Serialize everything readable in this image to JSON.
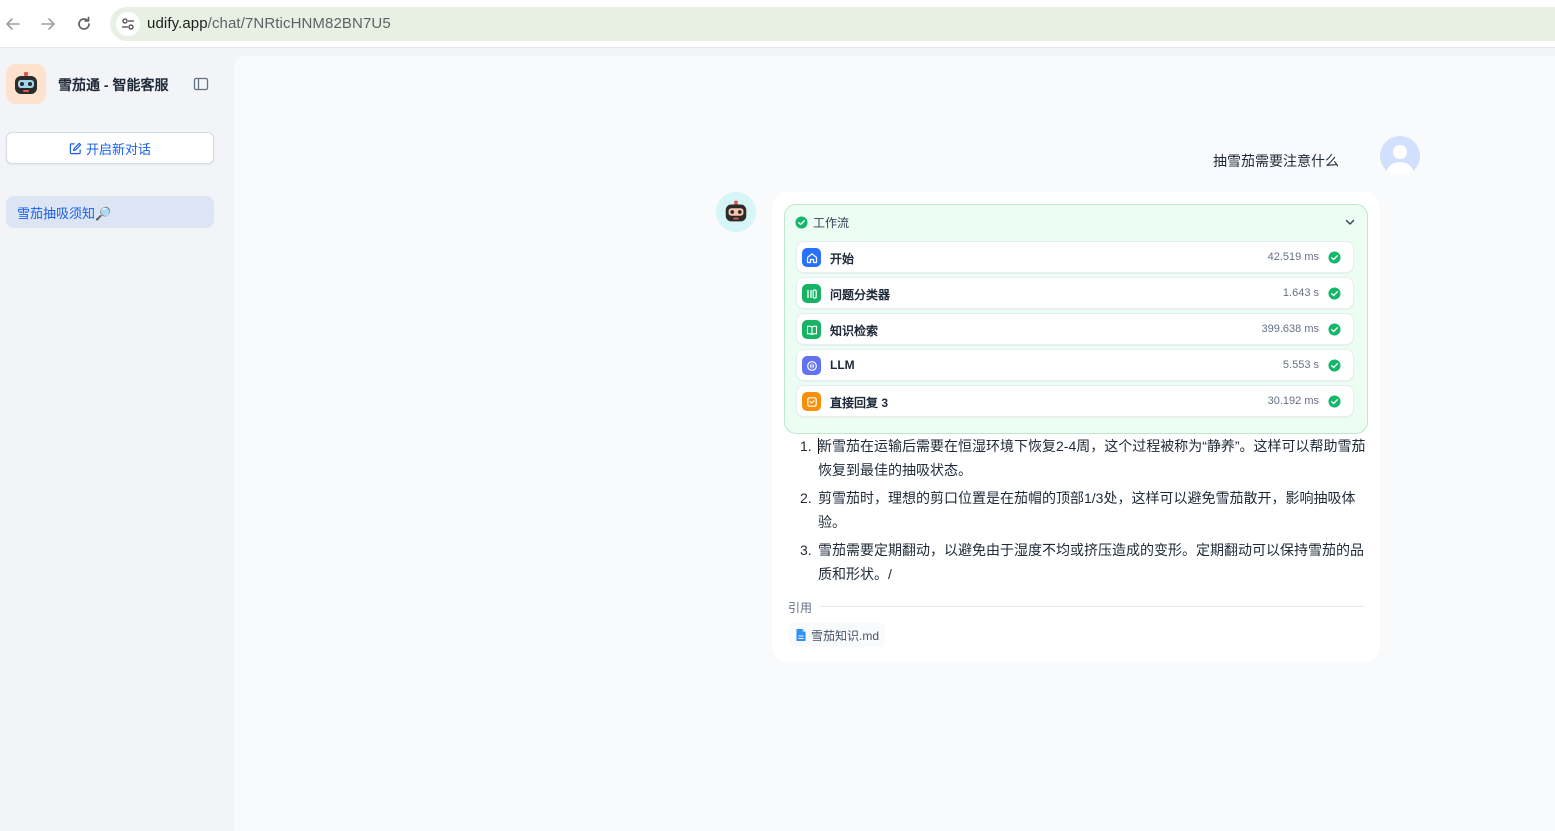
{
  "browser": {
    "url_host": "udify.app",
    "url_path": "/chat/7NRticHNM82BN7U5"
  },
  "sidebar": {
    "app_title": "雪茄通 - 智能客服",
    "new_chat_label": "开启新对话",
    "conversations": [
      {
        "label": "雪茄抽吸须知🔎"
      }
    ]
  },
  "chat": {
    "user_message": "抽雪茄需要注意什么",
    "workflow": {
      "title": "工作流",
      "nodes": [
        {
          "title": "开始",
          "time": "42.519 ms",
          "icon": "home-icon",
          "color": "#2970ff"
        },
        {
          "title": "问题分类器",
          "time": "1.643 s",
          "icon": "classifier-icon",
          "color": "#16b364"
        },
        {
          "title": "知识检索",
          "time": "399.638 ms",
          "icon": "book-icon",
          "color": "#16b364"
        },
        {
          "title": "LLM",
          "time": "5.553 s",
          "icon": "llm-icon",
          "color": "#6172f3"
        },
        {
          "title": "直接回复 3",
          "time": "30.192 ms",
          "icon": "reply-icon",
          "color": "#f79009"
        }
      ]
    },
    "answer": [
      {
        "num": "1.",
        "text": "新雪茄在运输后需要在恒湿环境下恢复2-4周，这个过程被称为“静养”。这样可以帮助雪茄恢复到最佳的抽吸状态。"
      },
      {
        "num": "2.",
        "text": "剪雪茄时，理想的剪口位置是在茄帽的顶部1/3处，这样可以避免雪茄散开，影响抽吸体验。"
      },
      {
        "num": "3.",
        "text": "雪茄需要定期翻动，以避免由于湿度不均或挤压造成的变形。定期翻动可以保持雪茄的品质和形状。/"
      }
    ],
    "citation_label": "引用",
    "citations": [
      {
        "name": "雪茄知识.md"
      }
    ]
  },
  "colors": {
    "accent": "#155eef",
    "success": "#12b76a",
    "workflow_bg": "#ecfdf3"
  }
}
